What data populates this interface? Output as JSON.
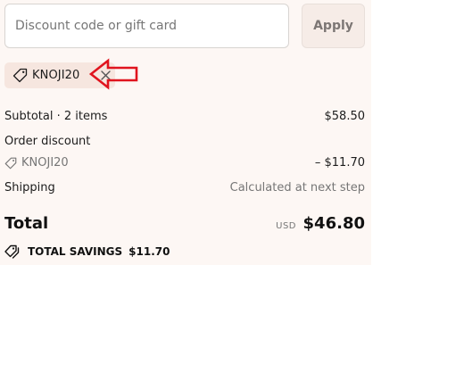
{
  "discount": {
    "placeholder": "Discount code or gift card",
    "value": "",
    "apply_label": "Apply",
    "applied_code": "KNOJI20"
  },
  "summary": {
    "subtotal_label": "Subtotal · 2 items",
    "subtotal_value": "$58.50",
    "order_discount_label": "Order discount",
    "discount_code": "KNOJI20",
    "discount_value": "– $11.70",
    "shipping_label": "Shipping",
    "shipping_value": "Calculated at next step",
    "total_label": "Total",
    "total_currency": "USD",
    "total_value": "$46.80",
    "savings_label": "TOTAL SAVINGS",
    "savings_value": "$11.70"
  },
  "colors": {
    "panel_background": "#fdf7f4",
    "chip_background": "#f6e6df",
    "annotation_arrow": "#e0141e"
  },
  "icons": {
    "tag": "tag-icon",
    "remove": "close-icon",
    "savings": "tags-icon",
    "annotation": "left-arrow-icon"
  }
}
